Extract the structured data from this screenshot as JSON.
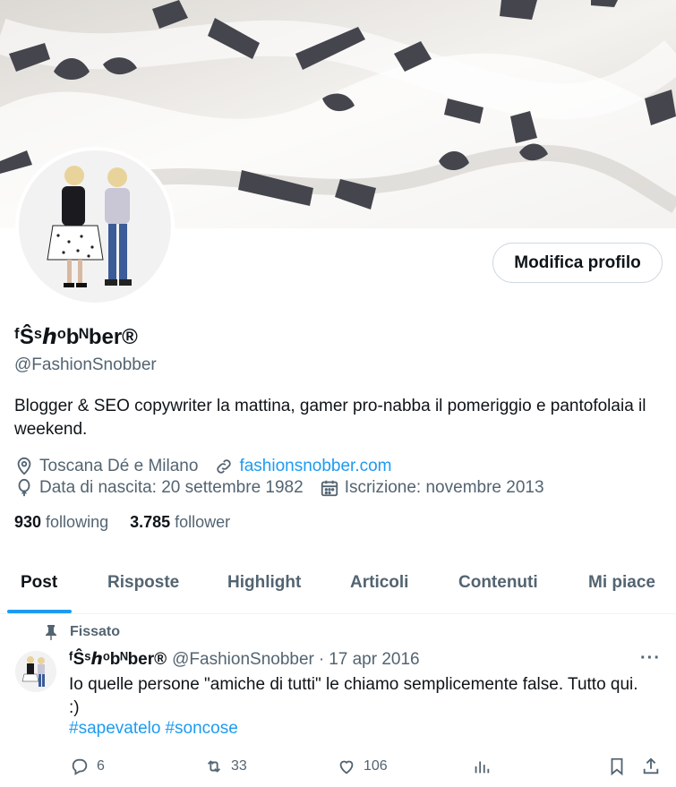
{
  "profile": {
    "display_name": "ᶠŜˢℎᵒbᴺber®",
    "handle": "@FashionSnobber",
    "bio": "Blogger & SEO copywriter la mattina, gamer pro-nabba il pomeriggio e pantofolaia il weekend.",
    "location": "Toscana Dé e Milano",
    "website": "fashionsnobber.com",
    "birthday": "Data di nascita: 20 settembre 1982",
    "joined": "Iscrizione: novembre 2013",
    "following_count": "930",
    "following_label": "following",
    "followers_count": "3.785",
    "followers_label": "follower",
    "edit_button": "Modifica profilo"
  },
  "tabs": [
    {
      "label": "Post",
      "active": true
    },
    {
      "label": "Risposte",
      "active": false
    },
    {
      "label": "Highlight",
      "active": false
    },
    {
      "label": "Articoli",
      "active": false
    },
    {
      "label": "Contenuti",
      "active": false
    },
    {
      "label": "Mi piace",
      "active": false
    }
  ],
  "pinned_tweet": {
    "pinned_label": "Fissato",
    "author_name": "ᶠŜˢℎᵒbᴺber®",
    "author_handle": "@FashionSnobber",
    "separator": "·",
    "date": "17 apr 2016",
    "text": "Io quelle persone \"amiche di tutti\" le chiamo semplicemente false. Tutto qui. :)",
    "hashtags": [
      "#sapevatelo",
      "#soncose"
    ],
    "more_label": "···",
    "replies": "6",
    "retweets": "33",
    "likes": "106"
  },
  "colors": {
    "accent": "#1d9bf0",
    "secondary_text": "#536471",
    "primary_text": "#0f1419"
  },
  "icons": [
    "location-icon",
    "link-icon",
    "balloon-icon",
    "calendar-icon",
    "pin-icon",
    "more-icon",
    "reply-icon",
    "retweet-icon",
    "like-icon",
    "views-icon",
    "bookmark-icon",
    "share-icon"
  ]
}
